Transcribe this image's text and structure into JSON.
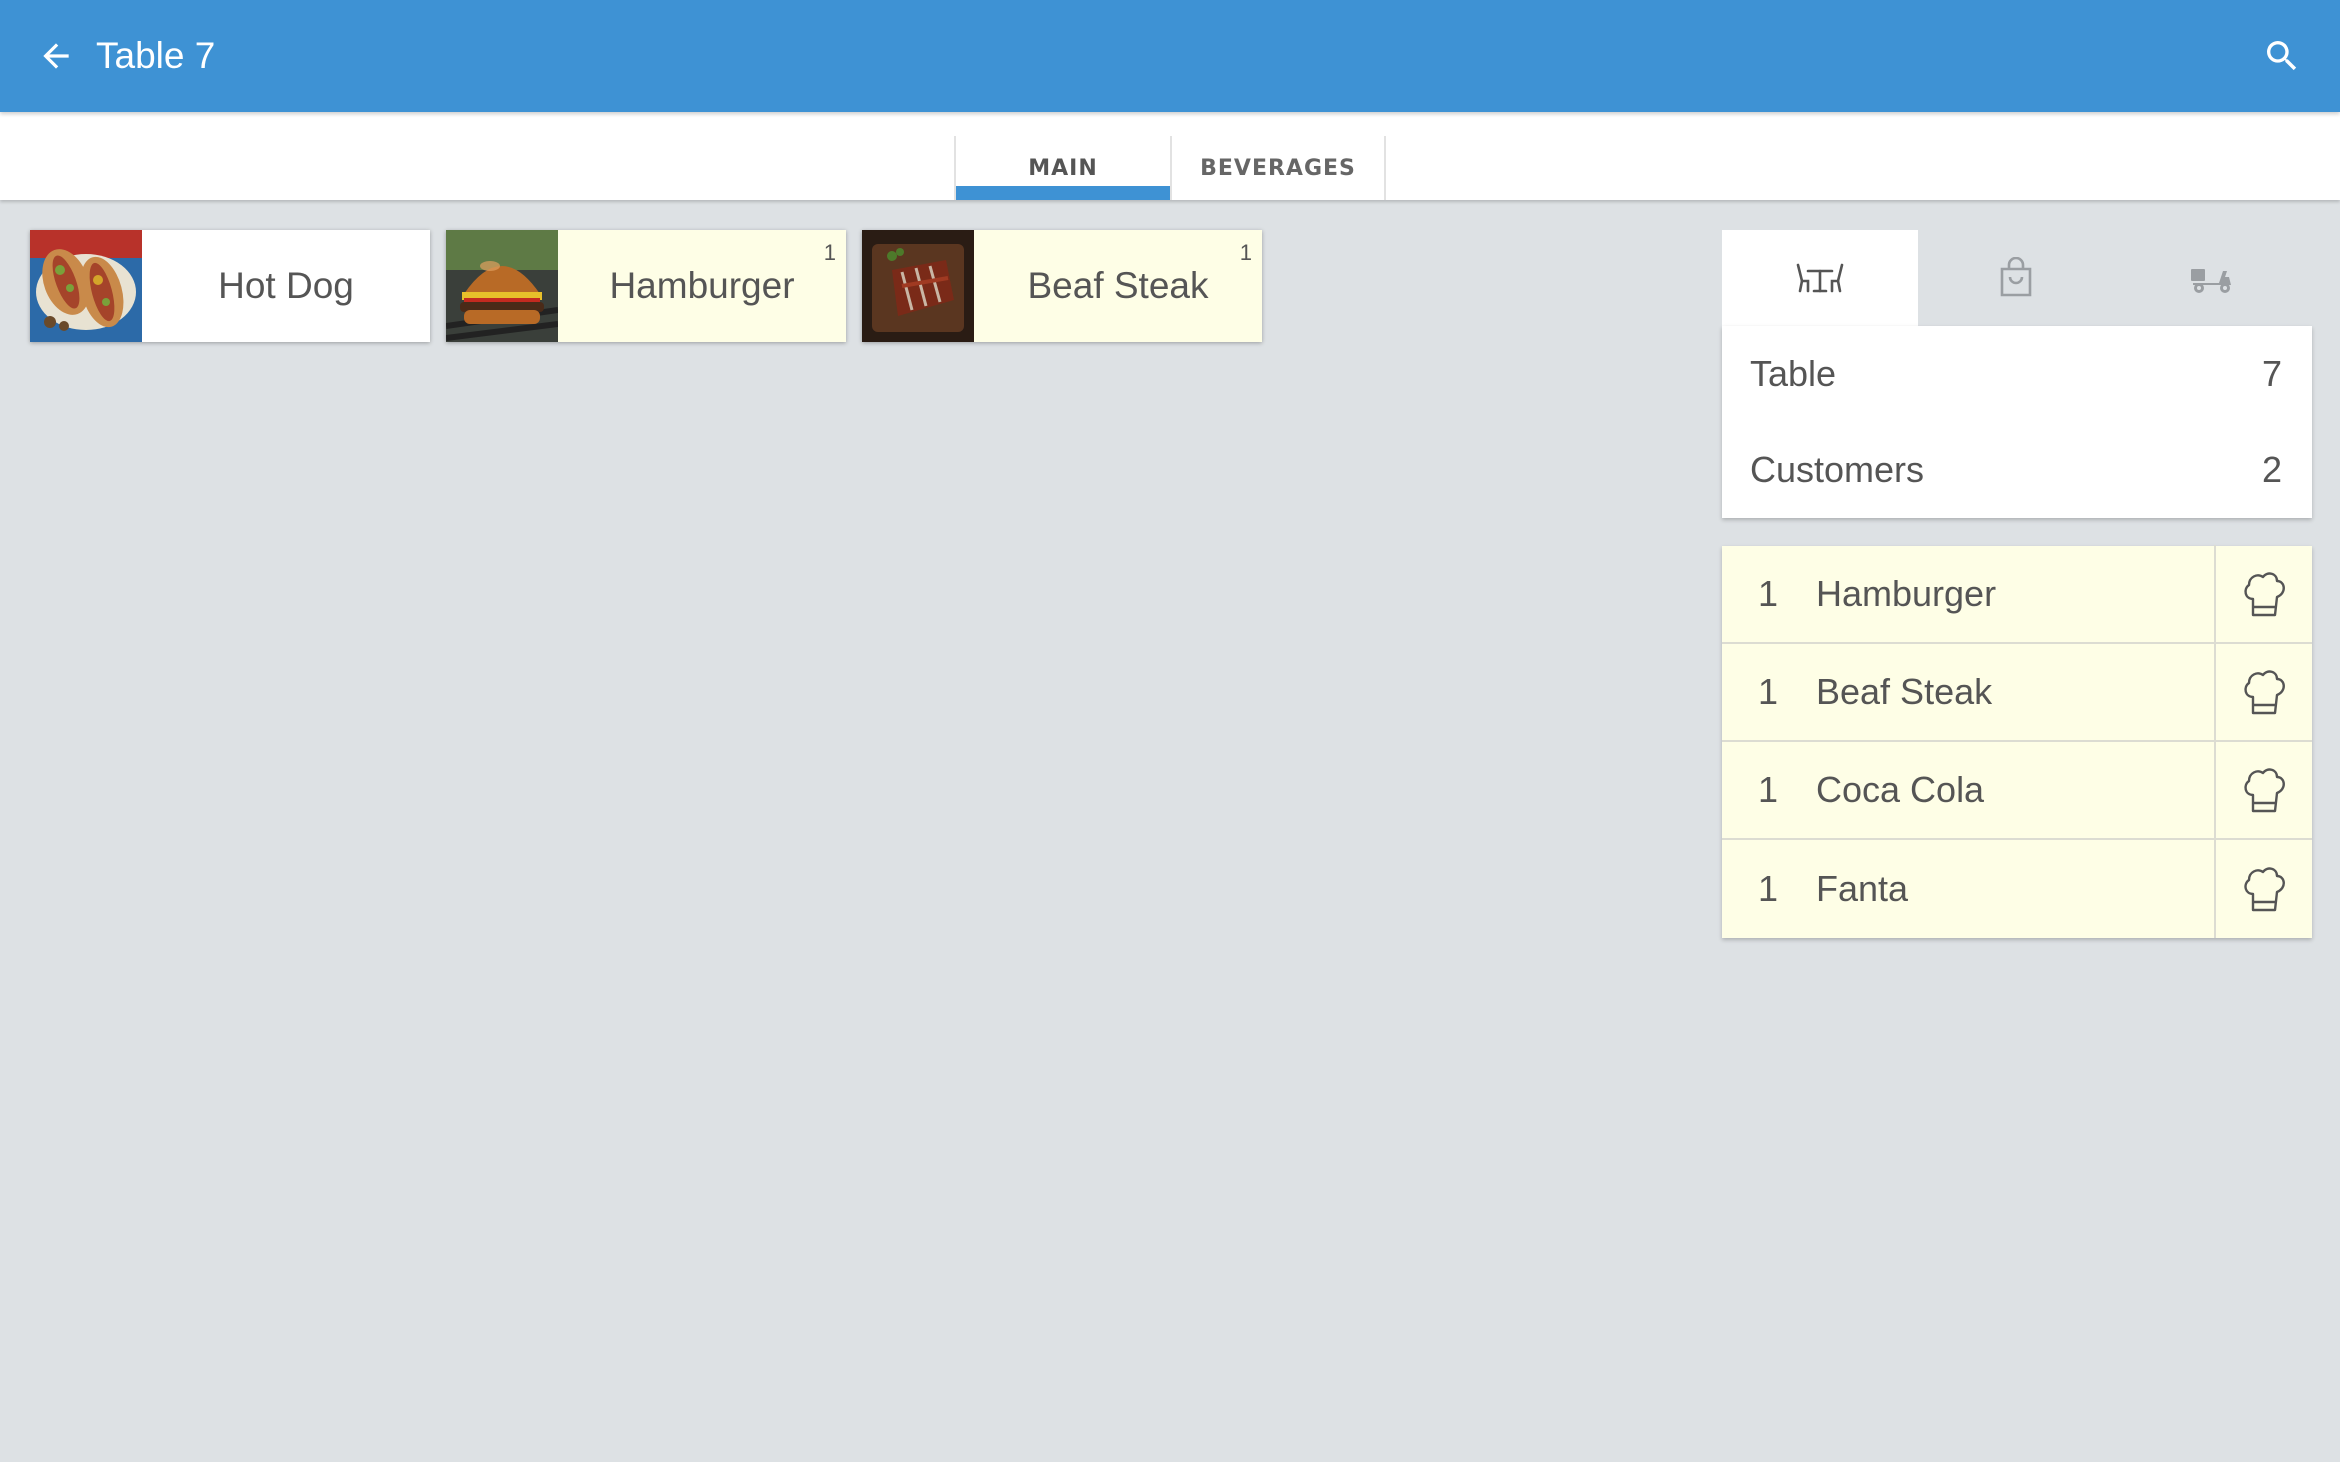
{
  "appbar": {
    "title": "Table 7",
    "back_icon": "arrow-left-icon",
    "search_icon": "search-icon",
    "color": "#3e92d4"
  },
  "tabs": [
    {
      "label": "MAIN",
      "active": true
    },
    {
      "label": "BEVERAGES",
      "active": false
    }
  ],
  "products": [
    {
      "name": "Hot Dog",
      "count": "",
      "selected": false
    },
    {
      "name": "Hamburger",
      "count": "1",
      "selected": true
    },
    {
      "name": "Beaf Steak",
      "count": "1",
      "selected": true
    }
  ],
  "order_types": [
    {
      "icon": "dine-in-table-icon",
      "active": true
    },
    {
      "icon": "takeaway-bag-icon",
      "active": false
    },
    {
      "icon": "delivery-scooter-icon",
      "active": false
    }
  ],
  "info": {
    "table_label": "Table",
    "table_value": "7",
    "customers_label": "Customers",
    "customers_value": "2"
  },
  "order_items": [
    {
      "qty": "1",
      "name": "Hamburger"
    },
    {
      "qty": "1",
      "name": "Beaf Steak"
    },
    {
      "qty": "1",
      "name": "Coca Cola"
    },
    {
      "qty": "1",
      "name": "Fanta"
    }
  ],
  "colors": {
    "background": "#dde1e4",
    "selected_item": "#fefee6",
    "accent": "#3e92d4"
  }
}
